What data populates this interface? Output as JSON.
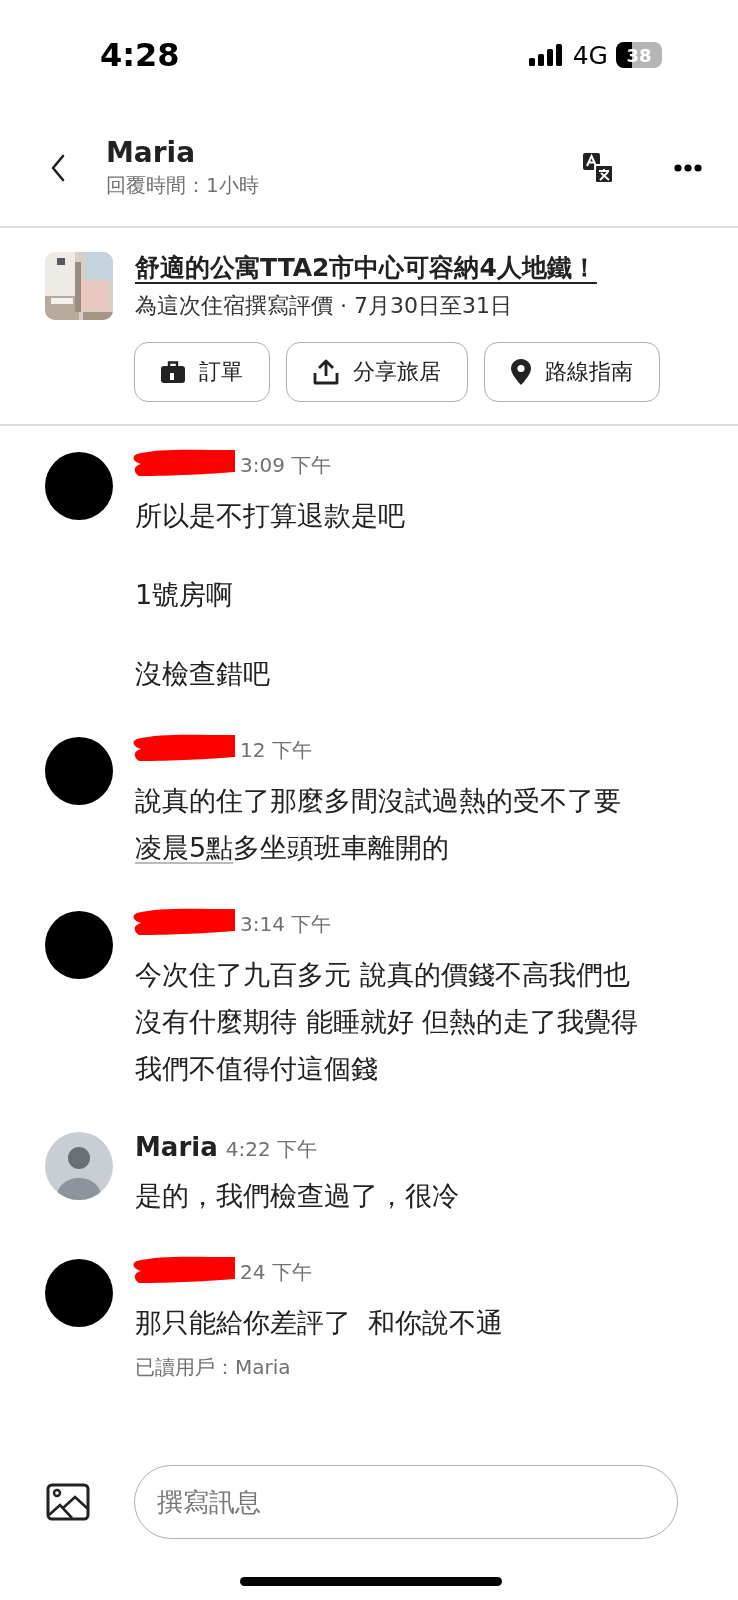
{
  "status_bar": {
    "time": "4:28",
    "network": "4G",
    "battery": "38"
  },
  "header": {
    "name": "Maria",
    "subtitle": "回覆時間：1小時"
  },
  "listing": {
    "title": "舒適的公寓TTA2市中心可容納4人地鐵！",
    "subtitle": "為這次住宿撰寫評價 · 7月30日至31日",
    "buttons": [
      {
        "kind": "order",
        "label": "訂單"
      },
      {
        "kind": "share",
        "label": "分享旅居"
      },
      {
        "kind": "directions",
        "label": "路線指南"
      }
    ]
  },
  "messages": [
    {
      "kind": "blacked",
      "redacted": true,
      "time": "3:09 下午",
      "paragraphs": [
        [
          [
            {
              "text": "所以是不打算退款是吧",
              "underlined": false
            }
          ]
        ],
        [
          [
            {
              "text": "1號房啊",
              "underlined": false
            }
          ]
        ],
        [
          [
            {
              "text": "沒檢查錯吧",
              "underlined": false
            }
          ]
        ]
      ]
    },
    {
      "kind": "blacked",
      "redacted": true,
      "time": "12 下午",
      "paragraphs": [
        [
          [
            {
              "text": "說真的住了那麼多間沒試過熱的受不了要",
              "underlined": false
            }
          ],
          [
            {
              "text": "凌晨5點",
              "underlined": true
            },
            {
              "text": "多坐頭班車離開的",
              "underlined": false
            }
          ]
        ]
      ]
    },
    {
      "kind": "blacked",
      "redacted": true,
      "time": "3:14 下午",
      "paragraphs": [
        [
          [
            {
              "text": "今次住了九百多元 說真的價錢不高我們也",
              "underlined": false
            }
          ],
          [
            {
              "text": "沒有什麼期待 能睡就好 但熱的走了我覺得",
              "underlined": false
            }
          ],
          [
            {
              "text": "我們不值得付這個錢",
              "underlined": false
            }
          ]
        ]
      ]
    },
    {
      "redacted": false,
      "sender": "Maria",
      "time": "4:22 下午",
      "paragraphs": [
        [
          [
            {
              "text": "是的，我們檢查過了，很冷",
              "underlined": false
            }
          ]
        ]
      ]
    },
    {
      "kind": "blacked",
      "redacted": true,
      "time": "24 下午",
      "paragraphs": [
        [
          [
            {
              "text": "那只能給你差評了  和你說不通",
              "underlined": false
            }
          ]
        ]
      ],
      "read_receipt": "已讀用戶：Maria"
    }
  ],
  "composer": {
    "placeholder": "撰寫訊息"
  }
}
